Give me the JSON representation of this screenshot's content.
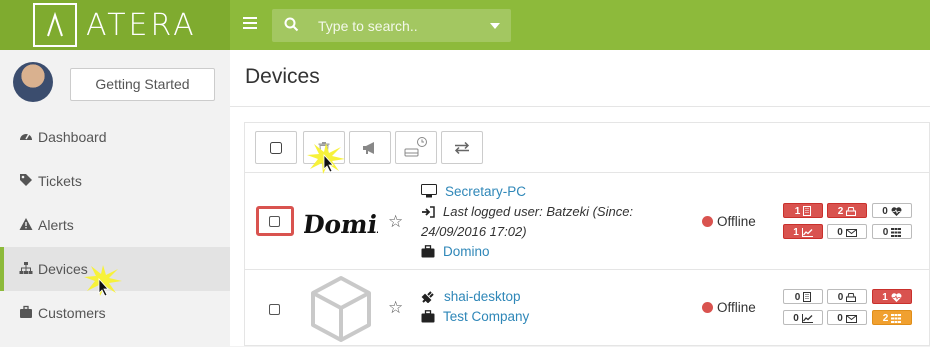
{
  "brand": {
    "logo_text": "ATERA",
    "logo_glyph": "Λ"
  },
  "search": {
    "placeholder": "Type to search.."
  },
  "sidebar": {
    "getting_started": "Getting Started",
    "items": [
      {
        "label": "Dashboard",
        "icon": "dashboard-icon"
      },
      {
        "label": "Tickets",
        "icon": "tag-icon"
      },
      {
        "label": "Alerts",
        "icon": "warning-icon"
      },
      {
        "label": "Devices",
        "icon": "sitemap-icon",
        "active": true
      },
      {
        "label": "Customers",
        "icon": "briefcase-icon"
      }
    ]
  },
  "main": {
    "title": "Devices"
  },
  "devices": [
    {
      "name": "Secretary-PC",
      "type_icon": "desktop-icon",
      "last_user": "Last logged user: Batzeki (Since:",
      "last_user_cont": "24/09/2016 17:02)",
      "customer": "Domino",
      "logo_text": "Domino.",
      "status": "Offline",
      "badges": [
        {
          "value": "1",
          "icon": "building-icon",
          "style": "red"
        },
        {
          "value": "2",
          "icon": "printer-icon",
          "style": "red"
        },
        {
          "value": "0",
          "icon": "heartbeat-icon",
          "style": "grey"
        },
        {
          "value": "1",
          "icon": "chart-icon",
          "style": "red"
        },
        {
          "value": "0",
          "icon": "envelope-icon",
          "style": "grey"
        },
        {
          "value": "0",
          "icon": "grid-icon",
          "style": "grey"
        }
      ]
    },
    {
      "name": "shai-desktop",
      "type_icon": "plug-icon",
      "customer": "Test Company",
      "status": "Offline",
      "badges": [
        {
          "value": "0",
          "icon": "building-icon",
          "style": "grey"
        },
        {
          "value": "0",
          "icon": "printer-icon",
          "style": "grey"
        },
        {
          "value": "1",
          "icon": "heartbeat-icon",
          "style": "red"
        },
        {
          "value": "0",
          "icon": "chart-icon",
          "style": "grey"
        },
        {
          "value": "0",
          "icon": "envelope-icon",
          "style": "grey"
        },
        {
          "value": "2",
          "icon": "grid-icon",
          "style": "orange"
        }
      ]
    }
  ],
  "colors": {
    "brand_green": "#8dba3b",
    "link_blue": "#2f87b8",
    "alert_red": "#d9534f",
    "warn_orange": "#f0a030"
  }
}
